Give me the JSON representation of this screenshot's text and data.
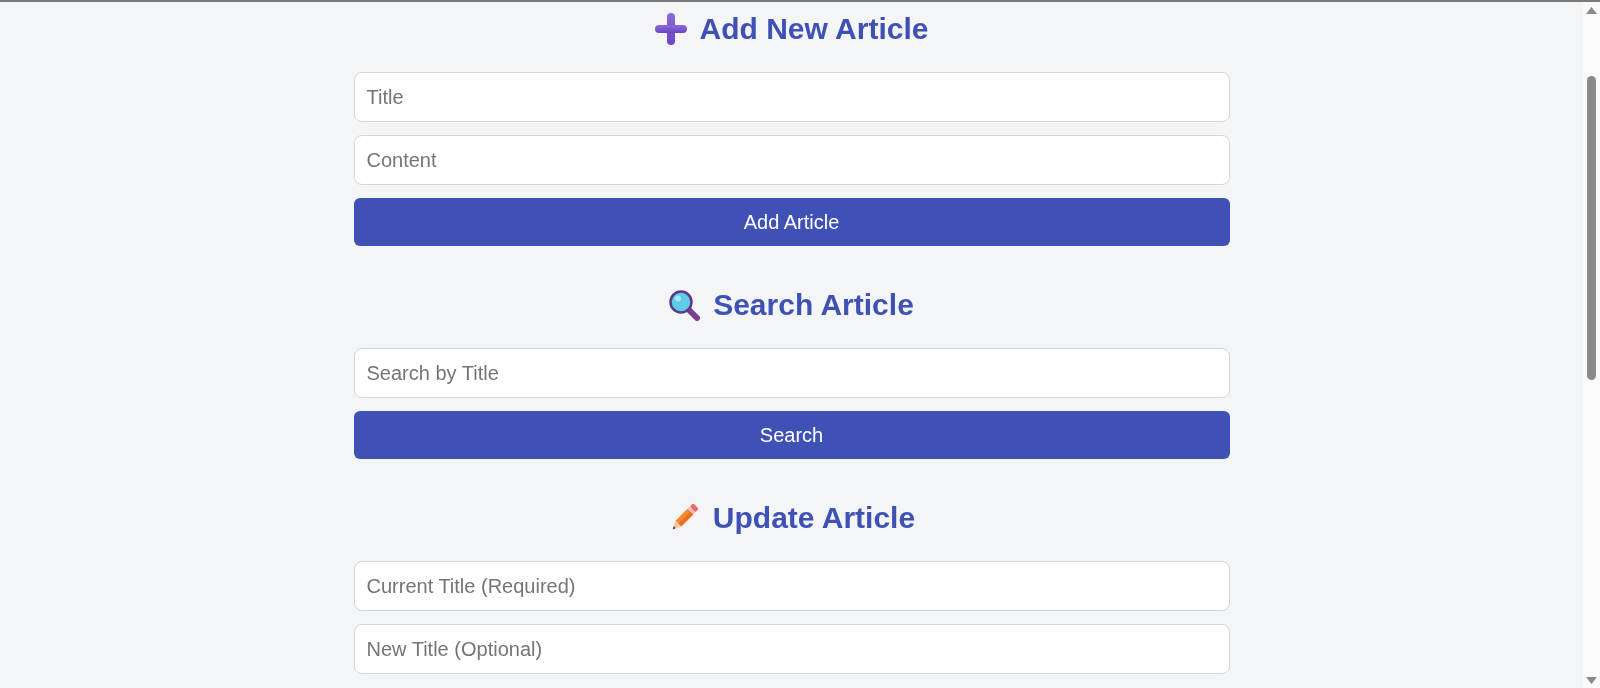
{
  "sections": [
    {
      "kind": "add",
      "heading": "Add New Article",
      "fields": [
        {
          "placeholder": "Title"
        },
        {
          "placeholder": "Content"
        }
      ],
      "button": "Add Article"
    },
    {
      "kind": "search",
      "heading": "Search Article",
      "fields": [
        {
          "placeholder": "Search by Title"
        }
      ],
      "button": "Search"
    },
    {
      "kind": "update",
      "heading": "Update Article",
      "fields": [
        {
          "placeholder": "Current Title (Required)"
        },
        {
          "placeholder": "New Title (Optional)"
        }
      ]
    }
  ]
}
